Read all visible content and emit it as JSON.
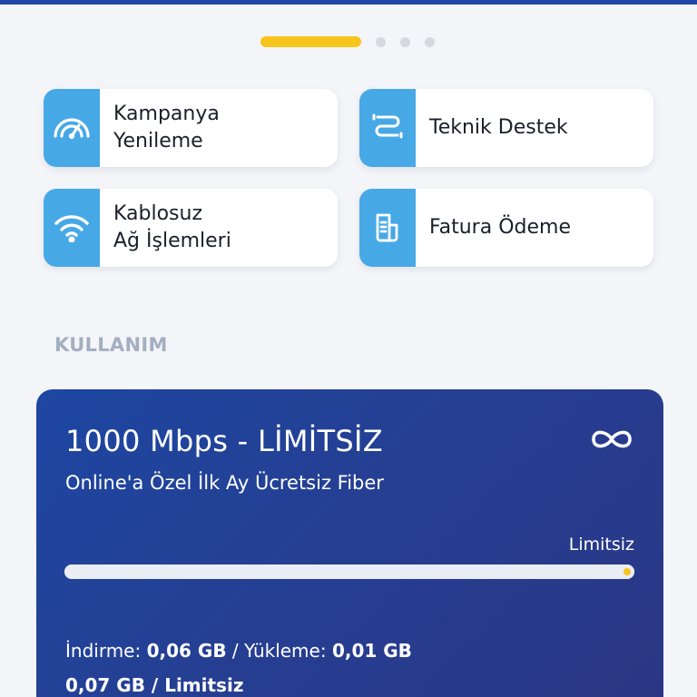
{
  "colors": {
    "accent_blue": "#47a8e6",
    "pager_active": "#f8c51c",
    "card_gradient_start": "#1d47a2",
    "card_gradient_end": "#2b3684",
    "section_title": "#a3afc1"
  },
  "pager": {
    "active_index": 0,
    "total": 4
  },
  "quick_actions": [
    {
      "label": "Kampanya\nYenileme",
      "icon": "speedometer-icon"
    },
    {
      "label": "Teknik Destek",
      "icon": "cable-connector-icon"
    },
    {
      "label": "Kablosuz\nAğ İşlemleri",
      "icon": "wifi-icon"
    },
    {
      "label": "Fatura Ödeme",
      "icon": "invoice-icon"
    }
  ],
  "usage": {
    "section_title": "KULLANIM",
    "plan_title": "1000 Mbps - LİMİTSİZ",
    "plan_subtitle": "Online'a Özel İlk Ay Ücretsiz Fiber",
    "plan_icon": "infinity-icon",
    "limit_label": "Limitsiz",
    "download_label": "İndirme: ",
    "download_value": "0,06 GB",
    "separator": " / ",
    "upload_label": "Yükleme: ",
    "upload_value": "0,01 GB",
    "total_used": "0,07 GB",
    "total_limit": "Limitsiz",
    "progress_fraction": 1.0
  }
}
